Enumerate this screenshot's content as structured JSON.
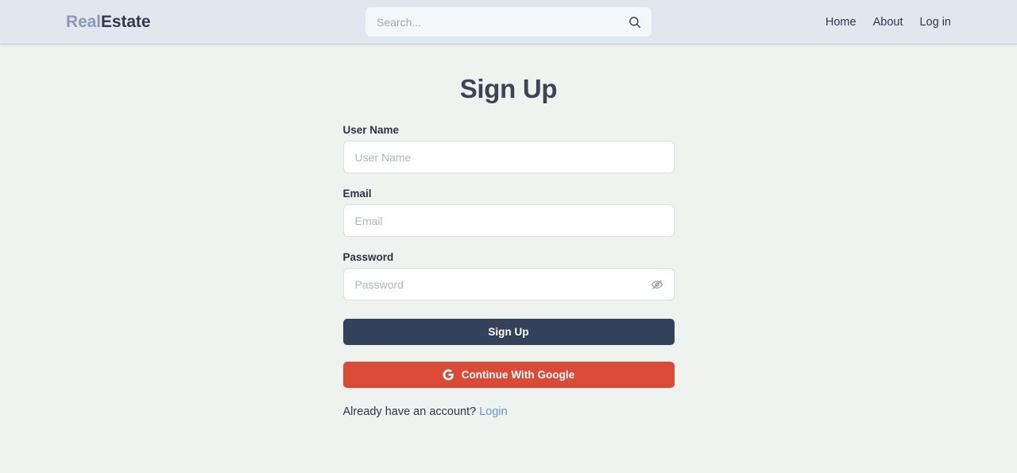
{
  "header": {
    "brand": {
      "part_one": "Real",
      "part_two": "Estate"
    },
    "search": {
      "placeholder": "Search...",
      "value": "",
      "icon": "search-icon"
    },
    "nav": [
      {
        "label": "Home"
      },
      {
        "label": "About"
      },
      {
        "label": "Log in"
      }
    ]
  },
  "main": {
    "title": "Sign Up",
    "fields": [
      {
        "label": "User Name",
        "placeholder": "User Name",
        "value": "",
        "type": "text"
      },
      {
        "label": "Email",
        "placeholder": "Email",
        "value": "",
        "type": "text"
      },
      {
        "label": "Password",
        "placeholder": "Password",
        "value": "",
        "type": "password",
        "toggle_icon": "eye-slash-icon"
      }
    ],
    "submit_label": "Sign Up",
    "google_label": "Continue With Google",
    "google_icon": "google-g-icon",
    "footer": {
      "prompt": "Already have an account?",
      "link_label": "Login"
    }
  },
  "colors": {
    "header_background": "#e1e7ef",
    "page_background": "#eff3ef",
    "brand_light": "#8c9bb0",
    "brand_dark": "#2f3b4c",
    "primary_button": "#33415a",
    "google_button": "#db4a37",
    "link": "#5b9bd5",
    "input_background": "#ffffff",
    "input_border": "#dcdfe3"
  }
}
